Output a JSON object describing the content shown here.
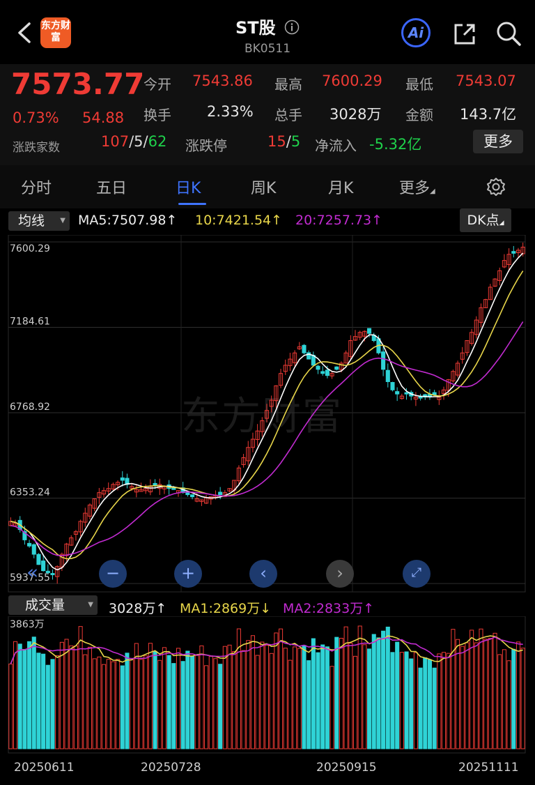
{
  "header": {
    "title": "ST股",
    "code": "BK0511",
    "logo_text": "东方财富",
    "ai_label": "Ai"
  },
  "quote": {
    "price": "7573.77",
    "change_pct": "0.73%",
    "change_amt": "54.88",
    "open_label": "今开",
    "open": "7543.86",
    "high_label": "最高",
    "high": "7600.29",
    "low_label": "最低",
    "low": "7543.07",
    "turnover_label": "换手",
    "turnover": "2.33%",
    "volume_label": "总手",
    "volume": "3028万",
    "amount_label": "金额",
    "amount": "143.7亿",
    "breadth_label": "涨跌家数",
    "breadth_up": "107",
    "breadth_flat": "5",
    "breadth_down": "62",
    "sep": "/",
    "limit_label": "涨跌停",
    "limit_up": "15",
    "limit_down": "5",
    "inflow_label": "净流入",
    "inflow": "-5.32亿",
    "more": "更多"
  },
  "tabs": [
    "分时",
    "五日",
    "日K",
    "周K",
    "月K",
    "更多"
  ],
  "active_tab": 2,
  "ma_bar": {
    "selector": "均线",
    "ma5": "MA5:7507.98↑",
    "ma10": "10:7421.54↑",
    "ma20": "20:7257.73↑",
    "dk": "DK点"
  },
  "price_axis": [
    "7600.29",
    "7184.61",
    "6768.92",
    "6353.24",
    "5937.55"
  ],
  "watermark": "东方财富",
  "volume_bar": {
    "selector": "成交量",
    "vol": "3028万↑",
    "ma1": "MA1:2869万↓",
    "ma2": "MA2:2833万↑",
    "max_label": "3863万"
  },
  "dates": [
    "20250611",
    "20250728",
    "20250915",
    "20251111"
  ],
  "colors": {
    "up": "#ef3b35",
    "down": "#2fd3d6",
    "ma5": "#ffffff",
    "ma10": "#e8d64a",
    "ma20": "#c12bd0",
    "accent": "#3f74ff"
  },
  "chart_data": {
    "type": "candlestick",
    "ylim": [
      5937.55,
      7600.29
    ],
    "y_ticks": [
      7600.29,
      7184.61,
      6768.92,
      6353.24,
      5937.55
    ],
    "close_series": [
      6240,
      6230,
      6200,
      6150,
      6120,
      6080,
      6030,
      6000,
      5990,
      5980,
      6020,
      6080,
      6130,
      6160,
      6190,
      6240,
      6280,
      6320,
      6350,
      6380,
      6390,
      6400,
      6420,
      6430,
      6440,
      6420,
      6410,
      6395,
      6395,
      6400,
      6410,
      6415,
      6420,
      6410,
      6400,
      6395,
      6390,
      6380,
      6370,
      6360,
      6350,
      6345,
      6355,
      6360,
      6365,
      6370,
      6380,
      6400,
      6440,
      6500,
      6550,
      6600,
      6640,
      6680,
      6730,
      6780,
      6830,
      6900,
      6960,
      7000,
      7030,
      7060,
      7090,
      7060,
      7030,
      7000,
      6980,
      6960,
      6950,
      6960,
      6980,
      7010,
      7060,
      7120,
      7140,
      7160,
      7165,
      7155,
      7120,
      7060,
      6980,
      6920,
      6880,
      6860,
      6850,
      6860,
      6850,
      6845,
      6840,
      6845,
      6850,
      6855,
      6845,
      6880,
      6930,
      6970,
      7010,
      7060,
      7120,
      7160,
      7220,
      7280,
      7320,
      7380,
      7420,
      7460,
      7510,
      7540,
      7545,
      7560,
      7575
    ],
    "volume_ma_max": 3863
  }
}
